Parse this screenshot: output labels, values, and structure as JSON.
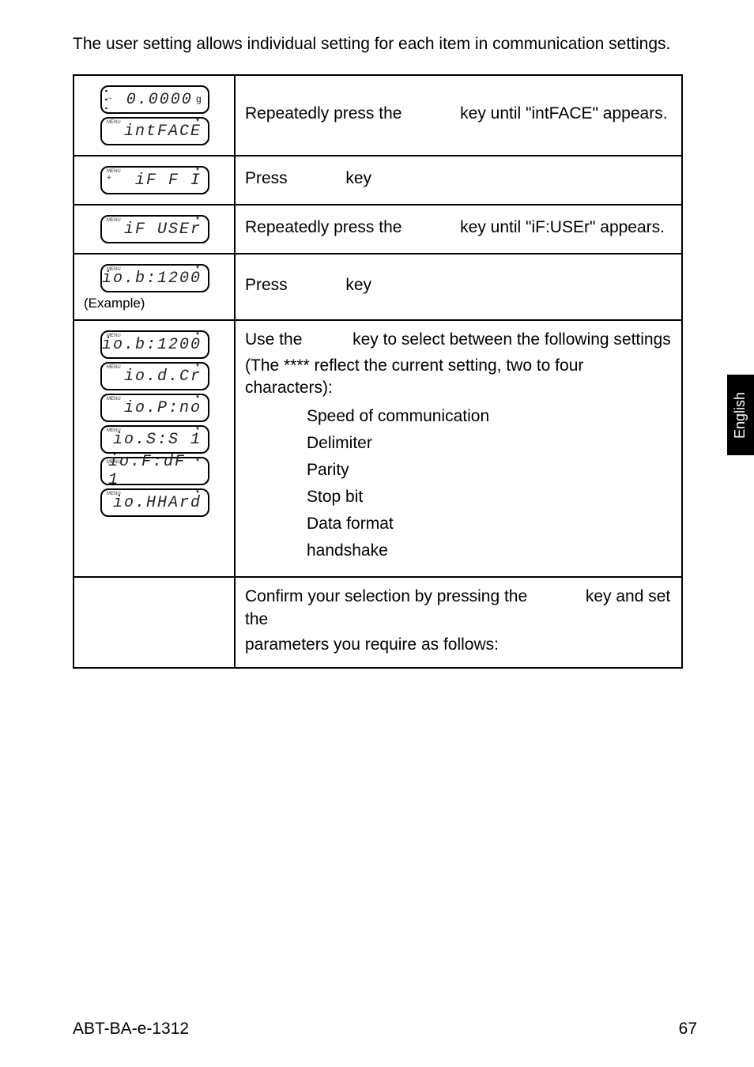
{
  "intro": "The user setting allows individual setting for each item in communication settings.",
  "rows": {
    "r1": {
      "lcd1": "0.0000",
      "lcd1_unit": "g",
      "lcd2": "intFACE",
      "text_a": "Repeatedly press the",
      "text_b": "key until \"intFACE\" appears."
    },
    "r2": {
      "lcd": "iF F I",
      "text_a": "Press",
      "text_b": "key"
    },
    "r3": {
      "lcd": "iF USEr",
      "text_a": "Repeatedly press the",
      "text_b": "key until \"iF:USEr\" appears."
    },
    "r4": {
      "lcd": "io.b:1200",
      "note": "(Example)",
      "text_a": "Press",
      "text_b": "key"
    },
    "r5": {
      "lcds": {
        "a": "io.b:1200",
        "b": "io.d.Cr",
        "c": "io.P:no",
        "d": "io.S:S 1",
        "e": "io.F:dF 1",
        "f": "io.HHArd"
      },
      "text_a": "Use the",
      "text_b": "key to select between the following settings",
      "text_c": "(The **** reflect the current setting, two to four characters):",
      "items": {
        "speed": "Speed of communication",
        "delim": "Delimiter",
        "parity": "Parity",
        "stop": "Stop bit",
        "data": "Data format",
        "hand": "handshake"
      }
    },
    "r6": {
      "text_a": "Confirm your selection by pressing the",
      "text_b": "key and set the",
      "text_c": "parameters you require as follows:"
    }
  },
  "side_tab": "English",
  "footer": {
    "left": "ABT-BA-e-1312",
    "right": "67"
  }
}
